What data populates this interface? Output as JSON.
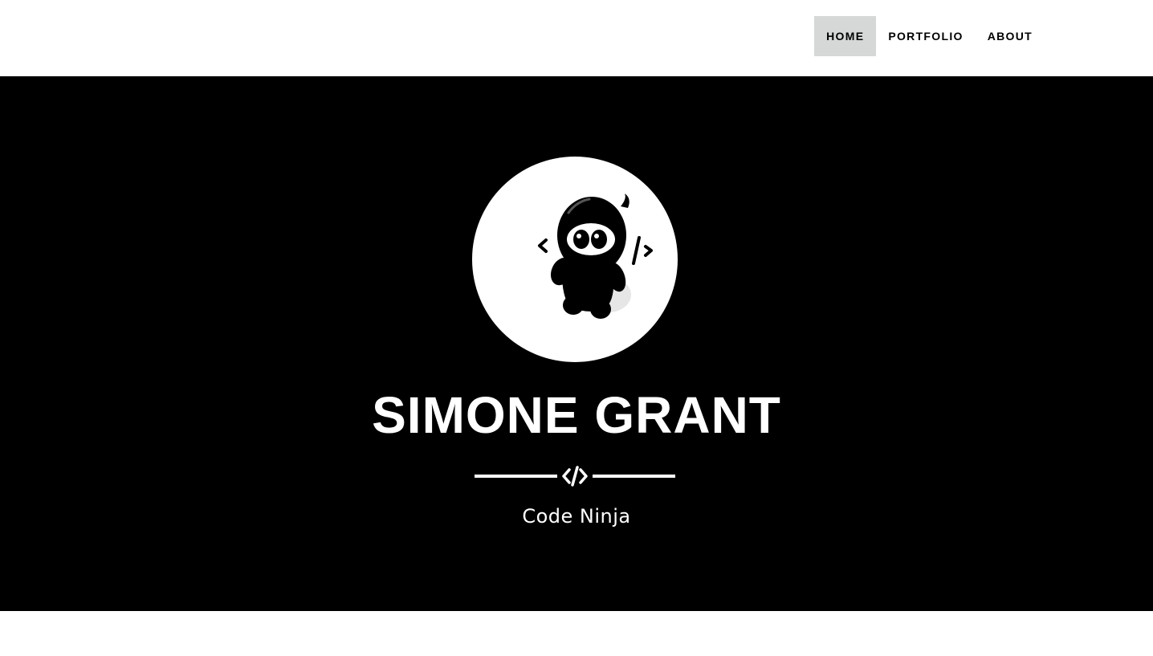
{
  "nav": {
    "items": [
      {
        "label": "HOME",
        "active": true
      },
      {
        "label": "PORTFOLIO",
        "active": false
      },
      {
        "label": "ABOUT",
        "active": false
      }
    ]
  },
  "hero": {
    "avatar_icon": "ninja-coder-icon",
    "name": "SIMONE GRANT",
    "divider_icon": "code-icon",
    "subtitle": "Code Ninja"
  },
  "colors": {
    "hero_background": "#000000",
    "nav_background": "#ffffff",
    "nav_active_background": "#d6d7d7",
    "text_light": "#ffffff",
    "text_dark": "#000000"
  }
}
